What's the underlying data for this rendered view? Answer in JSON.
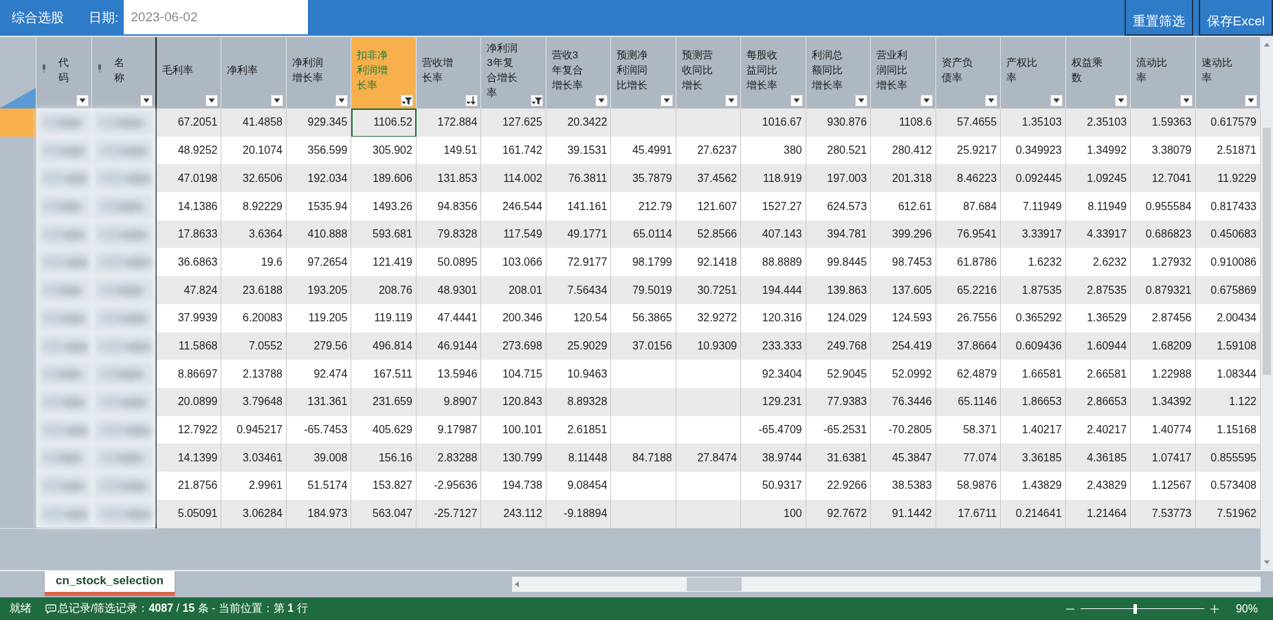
{
  "toolbar": {
    "title": "综合选股",
    "date_label": "日期:",
    "date_value": "2023-06-02",
    "buttons": [
      "重置筛选",
      "保存Excel"
    ]
  },
  "table": {
    "columns": [
      {
        "label": "代码",
        "kind": "dropdown",
        "selected": false,
        "pinned": true
      },
      {
        "label": "名称",
        "kind": "dropdown",
        "selected": false,
        "pinned": true
      },
      {
        "label": "毛利率",
        "kind": "dropdown",
        "selected": false,
        "pinned": false
      },
      {
        "label": "净利率",
        "kind": "dropdown",
        "selected": false,
        "pinned": false
      },
      {
        "label": "净利润增长率",
        "kind": "dropdown",
        "selected": false,
        "pinned": false
      },
      {
        "label": "扣非净利润增长率",
        "kind": "filtered",
        "selected": true,
        "pinned": false
      },
      {
        "label": "营收增长率",
        "kind": "sorted",
        "selected": false,
        "pinned": false
      },
      {
        "label": "净利润3年复合增长率",
        "kind": "filtered",
        "selected": false,
        "pinned": false
      },
      {
        "label": "营收3年复合增长率",
        "kind": "dropdown",
        "selected": false,
        "pinned": false
      },
      {
        "label": "预测净利润同比增长",
        "kind": "dropdown",
        "selected": false,
        "pinned": false
      },
      {
        "label": "预测营收同比增长",
        "kind": "dropdown",
        "selected": false,
        "pinned": false
      },
      {
        "label": "每股收益同比增长率",
        "kind": "dropdown",
        "selected": false,
        "pinned": false
      },
      {
        "label": "利润总额同比增长率",
        "kind": "dropdown",
        "selected": false,
        "pinned": false
      },
      {
        "label": "营业利润同比增长率",
        "kind": "dropdown",
        "selected": false,
        "pinned": false
      },
      {
        "label": "资产负债率",
        "kind": "dropdown",
        "selected": false,
        "pinned": false
      },
      {
        "label": "产权比率",
        "kind": "dropdown",
        "selected": false,
        "pinned": false
      },
      {
        "label": "权益乘数",
        "kind": "dropdown",
        "selected": false,
        "pinned": false
      },
      {
        "label": "流动比率",
        "kind": "dropdown",
        "selected": false,
        "pinned": false
      },
      {
        "label": "速动比率",
        "kind": "dropdown",
        "selected": false,
        "pinned": false
      }
    ],
    "rows": [
      {
        "selected": true,
        "cells": [
          "67.2051",
          "41.4858",
          "929.345",
          "1106.52",
          "172.884",
          "127.625",
          "20.3422",
          null,
          null,
          "1016.67",
          "930.876",
          "1108.6",
          "57.4655",
          "1.35103",
          "2.35103",
          "1.59363",
          "0.617579"
        ]
      },
      {
        "selected": false,
        "cells": [
          "48.9252",
          "20.1074",
          "356.599",
          "305.902",
          "149.51",
          "161.742",
          "39.1531",
          "45.4991",
          "27.6237",
          "380",
          "280.521",
          "280.412",
          "25.9217",
          "0.349923",
          "1.34992",
          "3.38079",
          "2.51871"
        ]
      },
      {
        "selected": false,
        "cells": [
          "47.0198",
          "32.6506",
          "192.034",
          "189.606",
          "131.853",
          "114.002",
          "76.3811",
          "35.7879",
          "37.4562",
          "118.919",
          "197.003",
          "201.318",
          "8.46223",
          "0.092445",
          "1.09245",
          "12.7041",
          "11.9229"
        ]
      },
      {
        "selected": false,
        "cells": [
          "14.1386",
          "8.92229",
          "1535.94",
          "1493.26",
          "94.8356",
          "246.544",
          "141.161",
          "212.79",
          "121.607",
          "1527.27",
          "624.573",
          "612.61",
          "87.684",
          "7.11949",
          "8.11949",
          "0.955584",
          "0.817433"
        ]
      },
      {
        "selected": false,
        "cells": [
          "17.8633",
          "3.6364",
          "410.888",
          "593.681",
          "79.8328",
          "117.549",
          "49.1771",
          "65.0114",
          "52.8566",
          "407.143",
          "394.781",
          "399.296",
          "76.9541",
          "3.33917",
          "4.33917",
          "0.686823",
          "0.450683"
        ]
      },
      {
        "selected": false,
        "cells": [
          "36.6863",
          "19.6",
          "97.2654",
          "121.419",
          "50.0895",
          "103.066",
          "72.9177",
          "98.1799",
          "92.1418",
          "88.8889",
          "99.8445",
          "98.7453",
          "61.8786",
          "1.6232",
          "2.6232",
          "1.27932",
          "0.910086"
        ]
      },
      {
        "selected": false,
        "cells": [
          "47.824",
          "23.6188",
          "193.205",
          "208.76",
          "48.9301",
          "208.01",
          "7.56434",
          "79.5019",
          "30.7251",
          "194.444",
          "139.863",
          "137.605",
          "65.2216",
          "1.87535",
          "2.87535",
          "0.879321",
          "0.675869"
        ]
      },
      {
        "selected": false,
        "cells": [
          "37.9939",
          "6.20083",
          "119.205",
          "119.119",
          "47.4441",
          "200.346",
          "120.54",
          "56.3865",
          "32.9272",
          "120.316",
          "124.029",
          "124.593",
          "26.7556",
          "0.365292",
          "1.36529",
          "2.87456",
          "2.00434"
        ]
      },
      {
        "selected": false,
        "cells": [
          "11.5868",
          "7.0552",
          "279.56",
          "496.814",
          "46.9144",
          "273.698",
          "25.9029",
          "37.0156",
          "10.9309",
          "233.333",
          "249.768",
          "254.419",
          "37.8664",
          "0.609436",
          "1.60944",
          "1.68209",
          "1.59108"
        ]
      },
      {
        "selected": false,
        "cells": [
          "8.86697",
          "2.13788",
          "92.474",
          "167.511",
          "13.5946",
          "104.715",
          "10.9463",
          null,
          null,
          "92.3404",
          "52.9045",
          "52.0992",
          "62.4879",
          "1.66581",
          "2.66581",
          "1.22988",
          "1.08344"
        ]
      },
      {
        "selected": false,
        "cells": [
          "20.0899",
          "3.79648",
          "131.361",
          "231.659",
          "9.8907",
          "120.843",
          "8.89328",
          null,
          null,
          "129.231",
          "77.9383",
          "76.3446",
          "65.1146",
          "1.86653",
          "2.86653",
          "1.34392",
          "1.122"
        ]
      },
      {
        "selected": false,
        "cells": [
          "12.7922",
          "0.945217",
          "-65.7453",
          "405.629",
          "9.17987",
          "100.101",
          "2.61851",
          null,
          null,
          "-65.4709",
          "-65.2531",
          "-70.2805",
          "58.371",
          "1.40217",
          "2.40217",
          "1.40774",
          "1.15168"
        ]
      },
      {
        "selected": false,
        "cells": [
          "14.1399",
          "3.03461",
          "39.008",
          "156.16",
          "2.83288",
          "130.799",
          "8.11448",
          "84.7188",
          "27.8474",
          "38.9744",
          "31.6381",
          "45.3847",
          "77.074",
          "3.36185",
          "4.36185",
          "1.07417",
          "0.855595"
        ]
      },
      {
        "selected": false,
        "cells": [
          "21.8756",
          "2.9961",
          "51.5174",
          "153.827",
          "-2.95636",
          "194.738",
          "9.08454",
          null,
          null,
          "50.9317",
          "22.9266",
          "38.5383",
          "58.9876",
          "1.43829",
          "2.43829",
          "1.12567",
          "0.573408"
        ]
      },
      {
        "selected": false,
        "cells": [
          "5.05091",
          "3.06284",
          "184.973",
          "563.047",
          "-25.7127",
          "243.112",
          "-9.18894",
          null,
          null,
          "100",
          "92.7672",
          "91.1442",
          "17.6711",
          "0.214641",
          "1.21464",
          "7.53773",
          "7.51962"
        ]
      }
    ]
  },
  "sheet_tabs": [
    {
      "label": "cn_stock_selection",
      "selected": true
    }
  ],
  "status_bar": {
    "ready": "就绪",
    "records": "总记录/筛选记录：**4087** / **15** 条 - 当前位置：第 **1** 行",
    "zoom": {
      "level": 0.43,
      "reading": "90%"
    }
  }
}
